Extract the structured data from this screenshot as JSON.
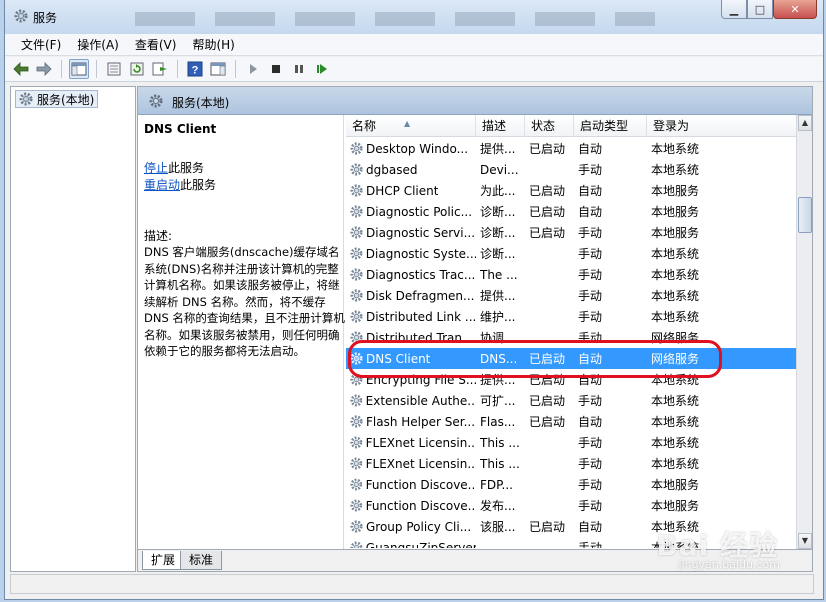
{
  "window": {
    "title": "服务"
  },
  "menu": [
    "文件(F)",
    "操作(A)",
    "查看(V)",
    "帮助(H)"
  ],
  "tree": {
    "root": "服务(本地)"
  },
  "header": {
    "title": "服务(本地)"
  },
  "detail": {
    "name": "DNS Client",
    "stop_link": "停止",
    "stop_suffix": "此服务",
    "restart_link": "重启动",
    "restart_suffix": "此服务",
    "desc_label": "描述:",
    "description": "DNS 客户端服务(dnscache)缓存域名系统(DNS)名称并注册该计算机的完整计算机名称。如果该服务被停止，将继续解析 DNS 名称。然而，将不缓存 DNS 名称的查询结果，且不注册计算机名称。如果该服务被禁用，则任何明确依赖于它的服务都将无法启动。"
  },
  "columns": [
    "名称",
    "描述",
    "状态",
    "启动类型",
    "登录为"
  ],
  "rows": [
    {
      "name": "Desktop Windo...",
      "desc": "提供...",
      "status": "已启动",
      "start": "自动",
      "logon": "本地系统"
    },
    {
      "name": "dgbased",
      "desc": "Devi...",
      "status": "",
      "start": "手动",
      "logon": "本地系统"
    },
    {
      "name": "DHCP Client",
      "desc": "为此...",
      "status": "已启动",
      "start": "自动",
      "logon": "本地服务"
    },
    {
      "name": "Diagnostic Polic...",
      "desc": "诊断...",
      "status": "已启动",
      "start": "自动",
      "logon": "本地服务"
    },
    {
      "name": "Diagnostic Servi...",
      "desc": "诊断...",
      "status": "已启动",
      "start": "手动",
      "logon": "本地服务"
    },
    {
      "name": "Diagnostic Syste...",
      "desc": "诊断...",
      "status": "",
      "start": "手动",
      "logon": "本地系统"
    },
    {
      "name": "Diagnostics Trac...",
      "desc": "The ...",
      "status": "",
      "start": "手动",
      "logon": "本地系统"
    },
    {
      "name": "Disk Defragmen...",
      "desc": "提供...",
      "status": "",
      "start": "手动",
      "logon": "本地系统"
    },
    {
      "name": "Distributed Link ...",
      "desc": "维护...",
      "status": "",
      "start": "手动",
      "logon": "本地系统"
    },
    {
      "name": "Distributed Tran...",
      "desc": "协调...",
      "status": "",
      "start": "手动",
      "logon": "网络服务"
    },
    {
      "name": "DNS Client",
      "desc": "DNS...",
      "status": "已启动",
      "start": "自动",
      "logon": "网络服务",
      "selected": true
    },
    {
      "name": "Encrypting File S...",
      "desc": "提供...",
      "status": "已启动",
      "start": "自动",
      "logon": "本地系统"
    },
    {
      "name": "Extensible Authe...",
      "desc": "可扩...",
      "status": "已启动",
      "start": "手动",
      "logon": "本地系统"
    },
    {
      "name": "Flash Helper Ser...",
      "desc": "Flas...",
      "status": "已启动",
      "start": "自动",
      "logon": "本地系统"
    },
    {
      "name": "FLEXnet Licensin...",
      "desc": "This ...",
      "status": "",
      "start": "手动",
      "logon": "本地系统"
    },
    {
      "name": "FLEXnet Licensin...",
      "desc": "This ...",
      "status": "",
      "start": "手动",
      "logon": "本地系统"
    },
    {
      "name": "Function Discove...",
      "desc": "FDP...",
      "status": "",
      "start": "手动",
      "logon": "本地服务"
    },
    {
      "name": "Function Discove...",
      "desc": "发布...",
      "status": "",
      "start": "手动",
      "logon": "本地服务"
    },
    {
      "name": "Group Policy Cli...",
      "desc": "该服...",
      "status": "已启动",
      "start": "自动",
      "logon": "本地系统"
    },
    {
      "name": "GuangsuZipServer",
      "desc": "",
      "status": "",
      "start": "手动",
      "logon": "本地系统"
    }
  ],
  "tabs": [
    "扩展",
    "标准"
  ],
  "watermark": {
    "brand": "Bai 经验",
    "url": "jingyan.baidu.com"
  },
  "colors": {
    "selection": "#3399ff",
    "highlight_ring": "#e01020",
    "link": "#0b52c4"
  }
}
